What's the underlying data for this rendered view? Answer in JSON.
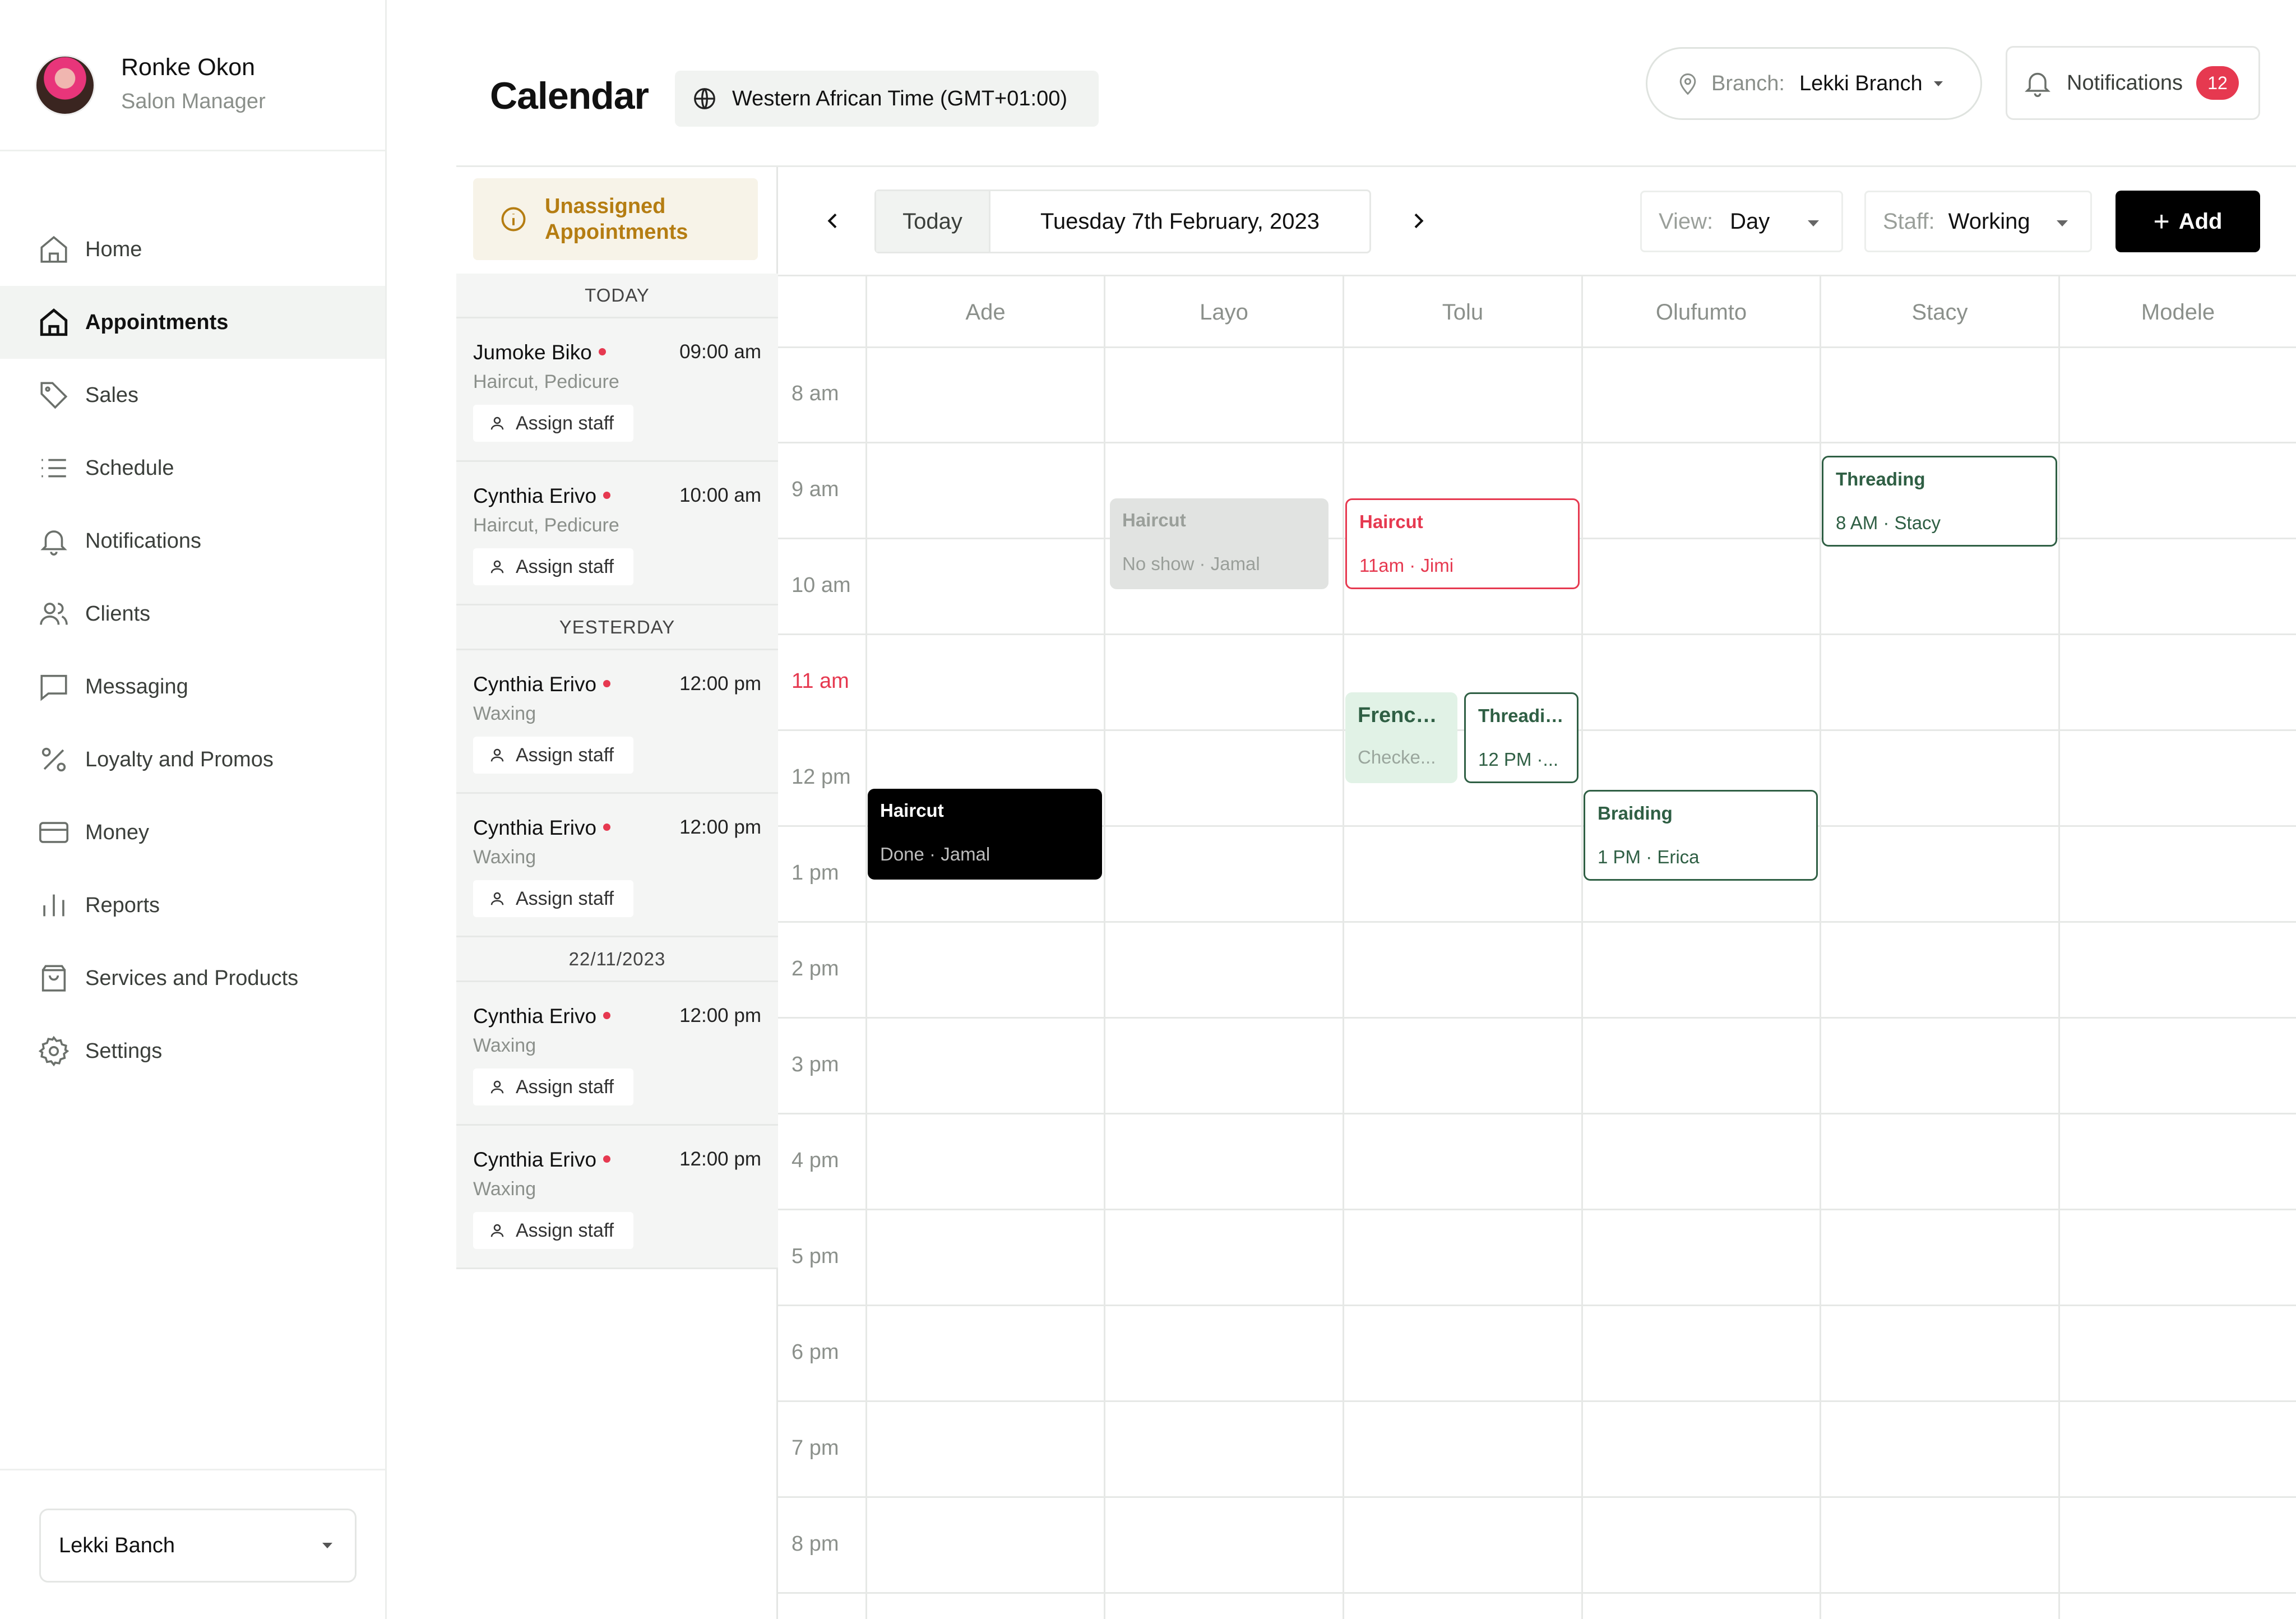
{
  "user": {
    "name": "Ronke Okon",
    "role": "Salon Manager"
  },
  "sidebar": {
    "items": [
      {
        "label": "Home",
        "icon": "home-icon"
      },
      {
        "label": "Appointments",
        "icon": "home-icon",
        "active": true
      },
      {
        "label": "Sales",
        "icon": "tag-icon"
      },
      {
        "label": "Schedule",
        "icon": "list-icon"
      },
      {
        "label": "Notifications",
        "icon": "bell-icon"
      },
      {
        "label": "Clients",
        "icon": "users-icon"
      },
      {
        "label": "Messaging",
        "icon": "message-icon"
      },
      {
        "label": "Loyalty and Promos",
        "icon": "percent-icon"
      },
      {
        "label": "Money",
        "icon": "card-icon"
      },
      {
        "label": "Reports",
        "icon": "bar-chart-icon"
      },
      {
        "label": "Services and Products",
        "icon": "bag-icon"
      },
      {
        "label": "Settings",
        "icon": "gear-icon"
      }
    ],
    "branch_select": "Lekki Banch"
  },
  "header": {
    "title": "Calendar",
    "timezone": "Western African Time (GMT+01:00)",
    "branch_label": "Branch:",
    "branch_value": "Lekki Branch",
    "notifications_label": "Notifications",
    "notifications_count": "12"
  },
  "unassigned": {
    "title": "Unassigned Appointments",
    "groups": [
      {
        "label": "TODAY",
        "items": [
          {
            "name": "Jumoke Biko",
            "time": "09:00 am",
            "services": "Haircut, Pedicure",
            "action": "Assign staff"
          },
          {
            "name": "Cynthia Erivo",
            "time": "10:00 am",
            "services": "Haircut, Pedicure",
            "action": "Assign staff"
          }
        ]
      },
      {
        "label": "YESTERDAY",
        "items": [
          {
            "name": "Cynthia Erivo",
            "time": "12:00 pm",
            "services": "Waxing",
            "action": "Assign staff"
          },
          {
            "name": "Cynthia Erivo",
            "time": "12:00 pm",
            "services": "Waxing",
            "action": "Assign staff"
          }
        ]
      },
      {
        "label": "22/11/2023",
        "items": [
          {
            "name": "Cynthia Erivo",
            "time": "12:00 pm",
            "services": "Waxing",
            "action": "Assign staff"
          },
          {
            "name": "Cynthia Erivo",
            "time": "12:00 pm",
            "services": "Waxing",
            "action": "Assign staff"
          }
        ]
      }
    ]
  },
  "toolbar": {
    "today": "Today",
    "date": "Tuesday 7th February, 2023",
    "view_label": "View:",
    "view_value": "Day",
    "staff_label": "Staff:",
    "staff_value": "Working",
    "add_label": "Add"
  },
  "calendar": {
    "staff": [
      "Ade",
      "Layo",
      "Tolu",
      "Olufumto",
      "Stacy",
      "Modele"
    ],
    "times": [
      "8 am",
      "9 am",
      "10 am",
      "11 am",
      "12 pm",
      "1 pm",
      "2 pm",
      "3 pm",
      "4 pm",
      "5 pm",
      "6 pm",
      "7 pm",
      "8 pm"
    ],
    "current_time": "11 am",
    "events": [
      {
        "title": "Haircut",
        "subtitle": "No show · Jamal",
        "style": "noshow"
      },
      {
        "title": "Haircut",
        "subtitle": "11am · Jimi",
        "style": "upcoming-red"
      },
      {
        "title": "Threading",
        "subtitle": "8 AM · Stacy",
        "style": "booked"
      },
      {
        "title": "French...",
        "subtitle": "Checke...",
        "style": "checked"
      },
      {
        "title": "Threading",
        "subtitle": "12 PM ·...",
        "style": "booked"
      },
      {
        "title": "Haircut",
        "subtitle": "Done · Jamal",
        "style": "done"
      },
      {
        "title": "Braiding",
        "subtitle": "1 PM · Erica",
        "style": "booked"
      }
    ]
  },
  "colors": {
    "accent_red": "#e63950",
    "green": "#2f5f44",
    "warning": "#b57d12"
  }
}
